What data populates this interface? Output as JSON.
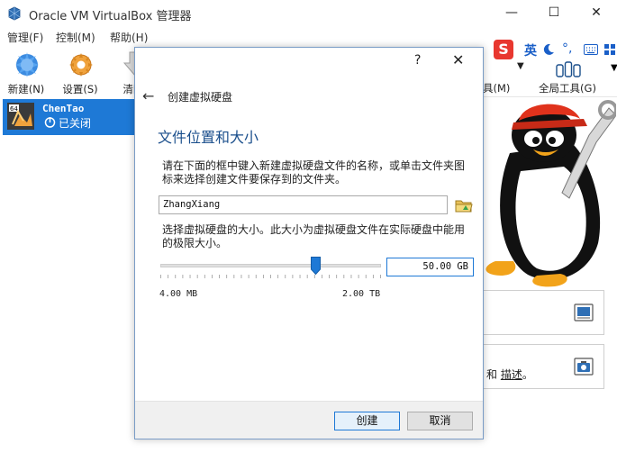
{
  "window": {
    "title": "Oracle VM VirtualBox 管理器",
    "minimize": "—",
    "maximize": "☐",
    "close": "✕"
  },
  "menu": {
    "items": [
      "管理(F)",
      "控制(M)",
      "帮助(H)"
    ]
  },
  "toolbar": {
    "new_label": "新建(N)",
    "settings_label": "设置(S)",
    "discard_label": "清除",
    "machine_tools_label": "具(M)",
    "global_tools_label": "全局工具(G)"
  },
  "vm_list": {
    "items": [
      {
        "name": "ChenTao",
        "state": "已关闭",
        "os_badge": "64"
      }
    ]
  },
  "ime": {
    "logo": "S",
    "mode": "英"
  },
  "right_panel": {
    "tools_text": "和",
    "tools_link": "描述",
    "tools_suffix": "。"
  },
  "dialog": {
    "help": "?",
    "close": "✕",
    "back": "←",
    "header": "创建虚拟硬盘",
    "section_title": "文件位置和大小",
    "location_desc": "请在下面的框中键入新建虚拟硬盘文件的名称，或单击文件夹图标来选择创建文件要保存到的文件夹。",
    "file_name": "ZhangXiang",
    "size_desc": "选择虚拟硬盘的大小。此大小为虚拟硬盘文件在实际硬盘中能用的极限大小。",
    "size_value": "50.00 GB",
    "size_min": "4.00 MB",
    "size_max": "2.00 TB",
    "slider_fraction": 0.7,
    "create_label": "创建",
    "cancel_label": "取消"
  },
  "colors": {
    "selection": "#1e79d6",
    "section_title": "#1b4f8c",
    "slider_thumb": "#1e79d6",
    "ime_logo": "#e8372f"
  }
}
